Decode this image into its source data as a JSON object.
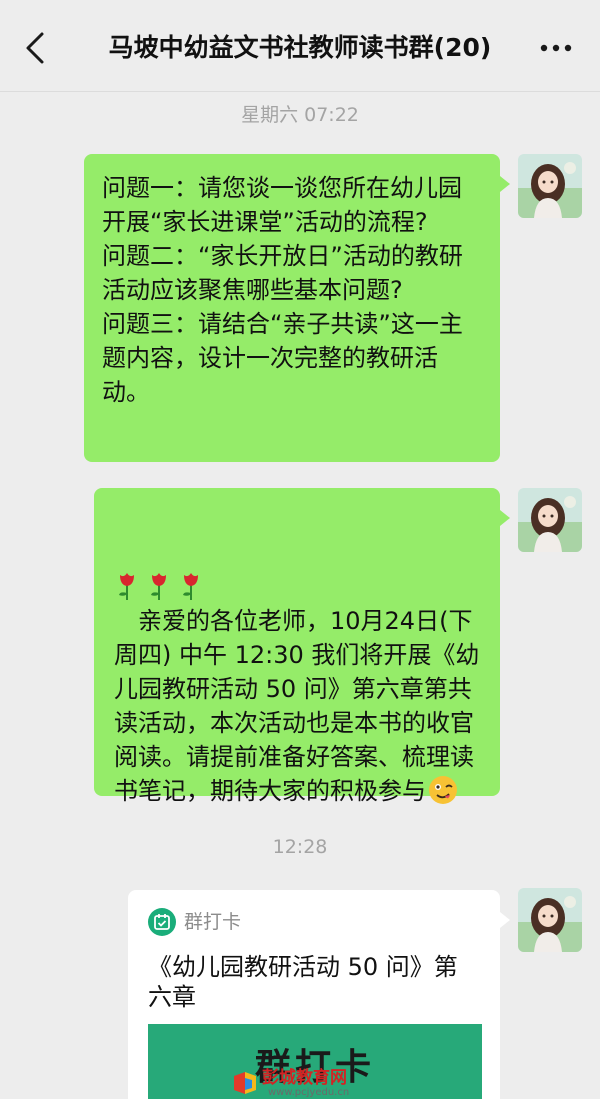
{
  "header": {
    "title": "马坡中幼益文书社教师读书群(20)",
    "back_icon": "chevron-left-icon",
    "more_icon": "more-dots-icon"
  },
  "messages": [
    {
      "type": "timestamp",
      "text": "星期六 07:22"
    },
    {
      "type": "text",
      "sender": "self",
      "text": "问题一：请您谈一谈您所在幼儿园开展“家长进课堂”活动的流程?\n问题二：“家长开放日”活动的教研活动应该聚焦哪些基本问题?\n问题三：请结合“亲子共读”这一主题内容，设计一次完整的教研活动。"
    },
    {
      "type": "text",
      "sender": "self",
      "emoji_leading": [
        "rose-icon",
        "rose-icon",
        "rose-icon"
      ],
      "text": "　亲爱的各位老师，10月24日(下周四) 中午 12:30 我们将开展《幼儿园教研活动 50 问》第六章第共读活动，本次活动也是本书的收官阅读。请提前准备好答案、梳理读书笔记，期待大家的积极参与",
      "emoji_trailing": "winking-face-icon"
    },
    {
      "type": "timestamp",
      "text": "12:28"
    },
    {
      "type": "card",
      "sender": "self",
      "app_icon": "calendar-check-icon",
      "app_name": "群打卡",
      "title": "《幼儿园教研活动 50 问》第六章",
      "banner_text": "群打卡"
    }
  ],
  "watermark": {
    "text": "彭城教育网",
    "url": "www.pcjyedu.cn"
  },
  "colors": {
    "background": "#ededed",
    "bubble_self": "#95ec69",
    "card_background": "#ffffff",
    "banner": "#27a979",
    "timestamp": "#a4a4a4"
  }
}
